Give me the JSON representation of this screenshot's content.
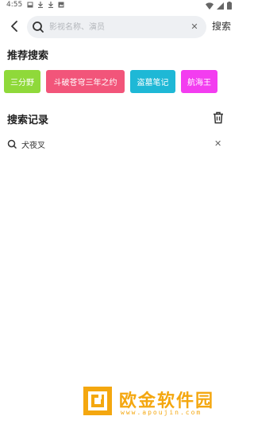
{
  "status_bar": {
    "time": "4:55",
    "left_icons": [
      "gallery-icon",
      "download-icon",
      "download-icon",
      "image-icon"
    ],
    "right_icons": [
      "wifi-icon",
      "signal-icon",
      "battery-icon"
    ]
  },
  "search": {
    "back_icon": "chevron-left-icon",
    "placeholder": "影视名称、演员",
    "value": "",
    "clear_icon": "close-icon",
    "submit_label": "搜索"
  },
  "recommend": {
    "title": "推荐搜索",
    "tags": [
      {
        "label": "三分野",
        "color": "#8fd93a"
      },
      {
        "label": "斗破苍穹三年之约",
        "color": "#f2557a"
      },
      {
        "label": "盗墓笔记",
        "color": "#1eb8d6"
      },
      {
        "label": "航海王",
        "color": "#f33df0"
      }
    ]
  },
  "history": {
    "title": "搜索记录",
    "clear_icon": "trash-icon",
    "items": [
      {
        "label": "犬夜叉",
        "delete_icon": "close-icon"
      }
    ]
  },
  "watermark": {
    "text": "欧金软件园",
    "url": "www.apoujin.com",
    "color": "#f4a70f"
  }
}
